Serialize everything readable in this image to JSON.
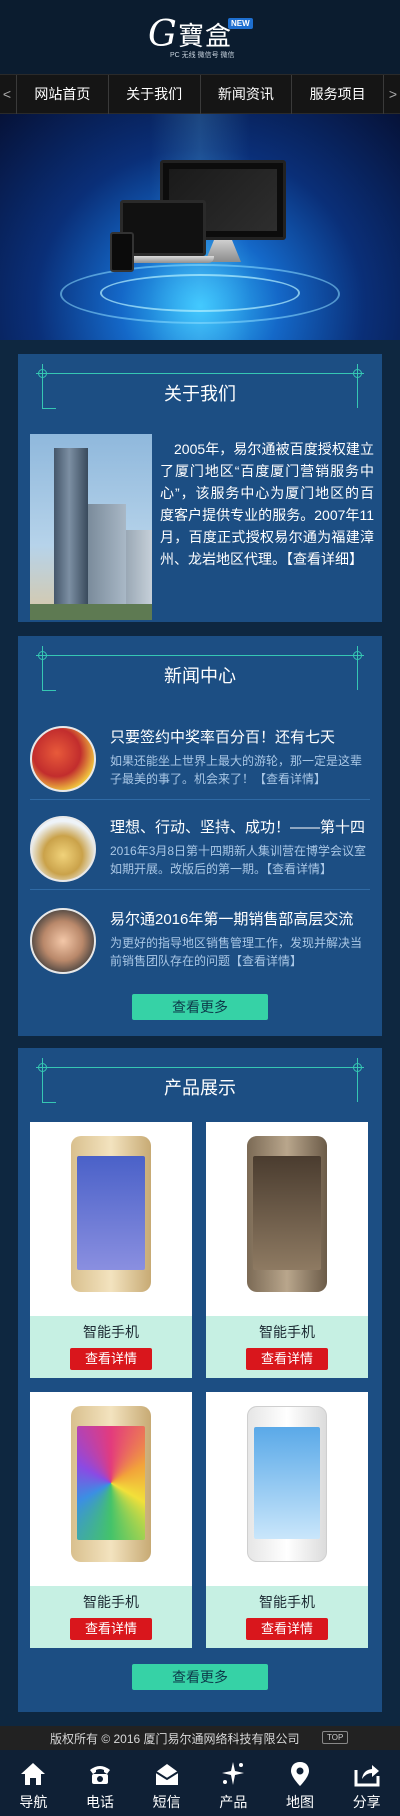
{
  "header": {
    "logo_letter": "G",
    "logo_name": "寶盒",
    "logo_badge": "NEW",
    "logo_sub": "PC 无线 微信号 微信"
  },
  "nav": {
    "items": [
      {
        "label": "网站首页"
      },
      {
        "label": "关于我们"
      },
      {
        "label": "新闻资讯"
      },
      {
        "label": "服务项目"
      }
    ],
    "left_arrow": "<",
    "right_arrow": ">"
  },
  "about": {
    "title": "关于我们",
    "text": "2005年，易尔通被百度授权建立了厦门地区“百度厦门营销服务中心”，该服务中心为厦门地区的百度客户提供专业的服务。2007年11月，百度正式授权易尔通为福建漳州、龙岩地区代理。【查看详细】"
  },
  "news": {
    "title": "新闻中心",
    "items": [
      {
        "title": "只要签约中奖率百分百！还有七天",
        "desc": "如果还能坐上世界上最大的游轮，那一定是这辈子最美的事了。机会来了！【查看详情】"
      },
      {
        "title": "理想、行动、坚持、成功！——第十四",
        "desc": "2016年3月8日第十四期新人集训营在博学会议室如期开展。改版后的第一期。【查看详情】"
      },
      {
        "title": "易尔通2016年第一期销售部高层交流",
        "desc": "为更好的指导地区销售管理工作，发现并解决当前销售团队存在的问题【查看详情】"
      }
    ],
    "more_label": "查看更多"
  },
  "products": {
    "title": "产品展示",
    "items": [
      {
        "name": "智能手机",
        "button": "查看详情"
      },
      {
        "name": "智能手机",
        "button": "查看详情"
      },
      {
        "name": "智能手机",
        "button": "查看详情"
      },
      {
        "name": "智能手机",
        "button": "查看详情"
      }
    ],
    "more_label": "查看更多"
  },
  "footer": {
    "copyright": "版权所有 © 2016 厦门易尔通网络科技有限公司",
    "top_label": "TOP"
  },
  "bottom_bar": {
    "items": [
      {
        "label": "导航",
        "icon": "home-icon"
      },
      {
        "label": "电话",
        "icon": "phone-icon"
      },
      {
        "label": "短信",
        "icon": "message-icon"
      },
      {
        "label": "产品",
        "icon": "sparkle-icon"
      },
      {
        "label": "地图",
        "icon": "map-pin-icon"
      },
      {
        "label": "分享",
        "icon": "share-icon"
      }
    ]
  },
  "colors": {
    "page_bg": "#0e2740",
    "panel_bg": "#1c4e83",
    "accent_green": "#36d2a6",
    "button_red": "#d9161c"
  }
}
